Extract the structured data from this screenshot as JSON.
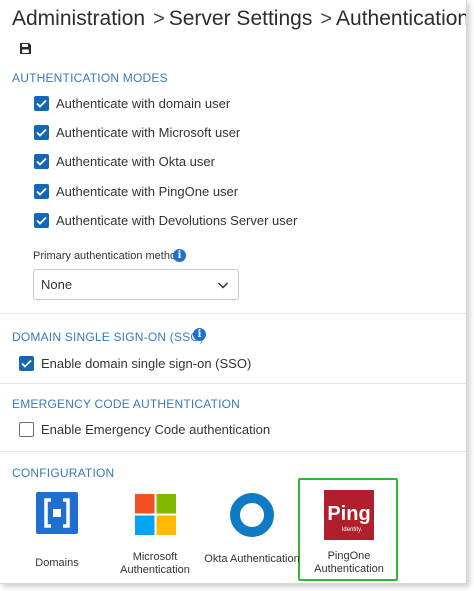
{
  "breadcrumb": {
    "items": [
      "Administration",
      "Server Settings",
      "Authentication"
    ],
    "separator": ">"
  },
  "toolbar": {
    "save_icon": "save-icon"
  },
  "auth_modes": {
    "title": "AUTHENTICATION MODES",
    "options": [
      {
        "label": "Authenticate with domain user",
        "checked": true
      },
      {
        "label": "Authenticate with Microsoft user",
        "checked": true
      },
      {
        "label": "Authenticate with Okta user",
        "checked": true
      },
      {
        "label": "Authenticate with PingOne user",
        "checked": true
      },
      {
        "label": "Authenticate with Devolutions Server user",
        "checked": true
      }
    ],
    "primary_label": "Primary authentication method",
    "primary_value": "None"
  },
  "sso": {
    "title": "DOMAIN SINGLE SIGN-ON (SSO)",
    "option": {
      "label": "Enable domain single sign-on (SSO)",
      "checked": true
    }
  },
  "emergency": {
    "title": "EMERGENCY CODE AUTHENTICATION",
    "option": {
      "label": "Enable Emergency Code authentication",
      "checked": false
    }
  },
  "configuration": {
    "title": "CONFIGURATION",
    "tiles": [
      {
        "label": "Domains",
        "icon": "domains-icon"
      },
      {
        "label": "Microsoft Authentication",
        "icon": "microsoft-logo-icon"
      },
      {
        "label": "Okta Authentication",
        "icon": "okta-logo-icon"
      },
      {
        "label": "PingOne Authentication",
        "icon": "ping-identity-logo-icon",
        "logo_text": "Ping",
        "logo_subtext": "Identity.",
        "highlighted": true
      }
    ]
  },
  "colors": {
    "accent": "#3a7ab8",
    "checkbox": "#1565b8",
    "info": "#1f6fd1",
    "highlight": "#2fb830",
    "domains_blue": "#1f6fd1",
    "okta_blue": "#0f7bc4",
    "ping_red": "#b21f2c"
  }
}
